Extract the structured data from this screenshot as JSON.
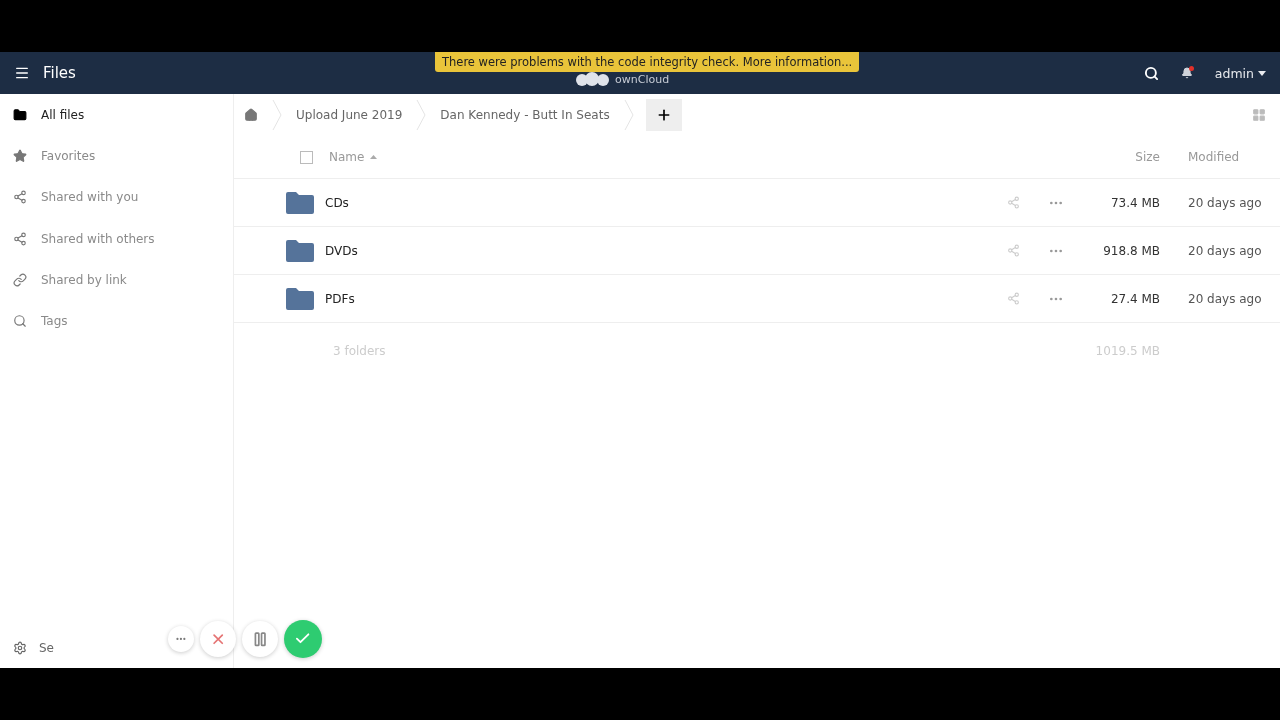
{
  "header": {
    "app_title": "Files",
    "banner": "There were problems with the code integrity check. More information...",
    "logo_text": "ownCloud",
    "notifications_unread": true,
    "user": "admin"
  },
  "sidebar": {
    "items": [
      {
        "label": "All files",
        "kind": "folder",
        "selected": true
      },
      {
        "label": "Favorites",
        "kind": "star",
        "selected": false
      },
      {
        "label": "Shared with you",
        "kind": "share",
        "selected": false
      },
      {
        "label": "Shared with others",
        "kind": "share",
        "selected": false
      },
      {
        "label": "Shared by link",
        "kind": "link",
        "selected": false
      },
      {
        "label": "Tags",
        "kind": "search",
        "selected": false
      }
    ],
    "settings_label": "Se"
  },
  "breadcrumbs": [
    "Upload June 2019",
    "Dan Kennedy - Butt In Seats"
  ],
  "table": {
    "select_all_checked": false,
    "columns": {
      "name": "Name",
      "size": "Size",
      "modified": "Modified"
    },
    "sorted_ascending": true,
    "rows": [
      {
        "kind": "folder",
        "name": "CDs",
        "size": "73.4 MB",
        "modified": "20 days ago",
        "checked": false
      },
      {
        "kind": "folder",
        "name": "DVDs",
        "size": "918.8 MB",
        "modified": "20 days ago",
        "checked": false
      },
      {
        "kind": "folder",
        "name": "PDFs",
        "size": "27.4 MB",
        "modified": "20 days ago",
        "checked": false
      }
    ],
    "summary": {
      "count": "3 folders",
      "size": "1019.5 MB"
    }
  },
  "recorder": [
    {
      "kind": "more"
    },
    {
      "kind": "cancel"
    },
    {
      "kind": "pause"
    },
    {
      "kind": "done"
    }
  ]
}
